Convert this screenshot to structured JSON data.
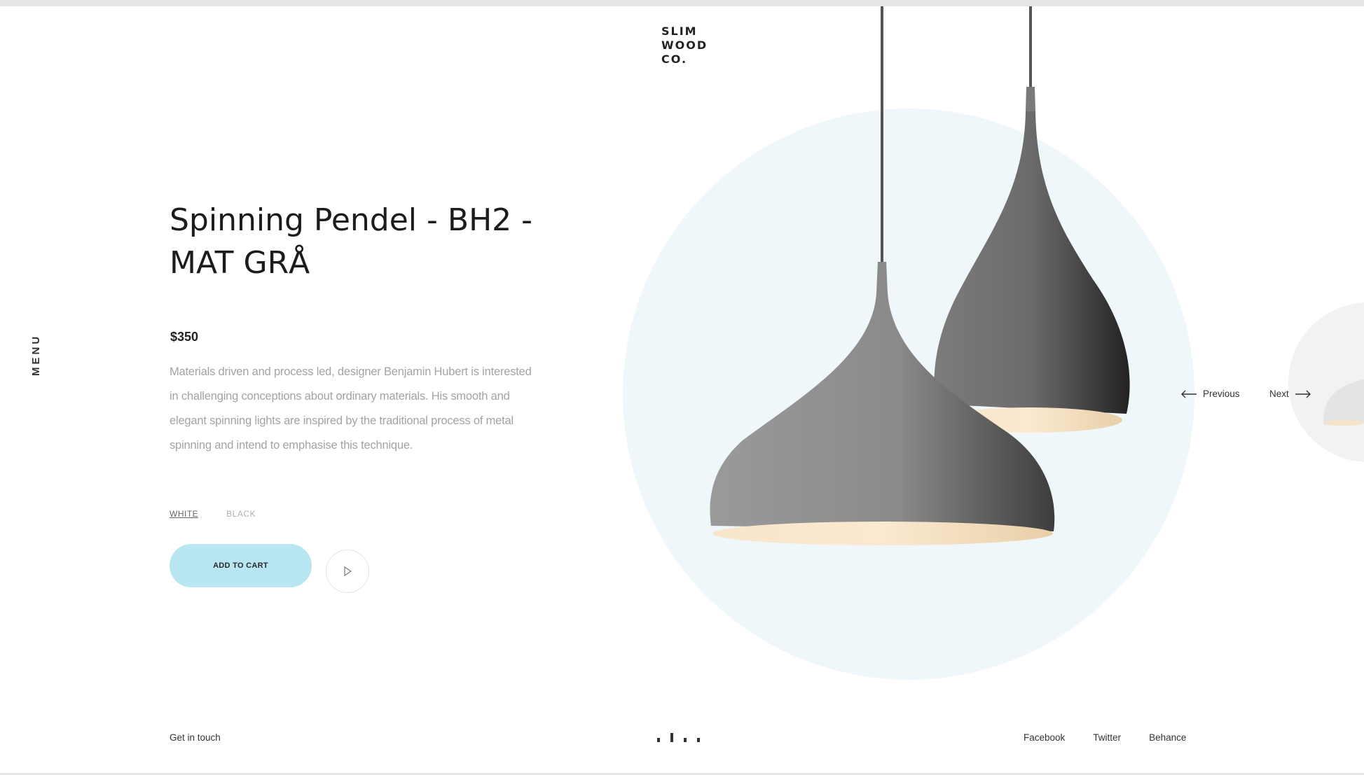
{
  "nav": {
    "menu_label": "MENU"
  },
  "brand": {
    "logo_lines": [
      "SLIM",
      "WOOD",
      "CO."
    ]
  },
  "product": {
    "title": "Spinning Pendel - BH2 - MAT GRÅ",
    "price": "$350",
    "description": "Materials driven and process led, designer Benjamin Hubert is interested in challenging conceptions about ordinary materials. His smooth and elegant spinning lights are inspired by the traditional process of metal spinning and intend to emphasise this technique.",
    "variants": [
      {
        "label": "WHITE",
        "selected": true
      },
      {
        "label": "BLACK",
        "selected": false
      }
    ],
    "add_to_cart_label": "ADD TO CART"
  },
  "carousel": {
    "previous_label": "Previous",
    "next_label": "Next",
    "slide_count": 4,
    "active_slide": 2
  },
  "footer": {
    "contact_label": "Get in touch",
    "social": [
      "Facebook",
      "Twitter",
      "Behance"
    ]
  },
  "colors": {
    "accent_button": "#b8e6f3",
    "hero_circle": "#eff7fb",
    "lamp_body": "#8f8f8f",
    "lamp_inner": "#f5dcb8"
  },
  "icons": [
    "play-icon",
    "arrow-left-icon",
    "arrow-right-icon"
  ]
}
